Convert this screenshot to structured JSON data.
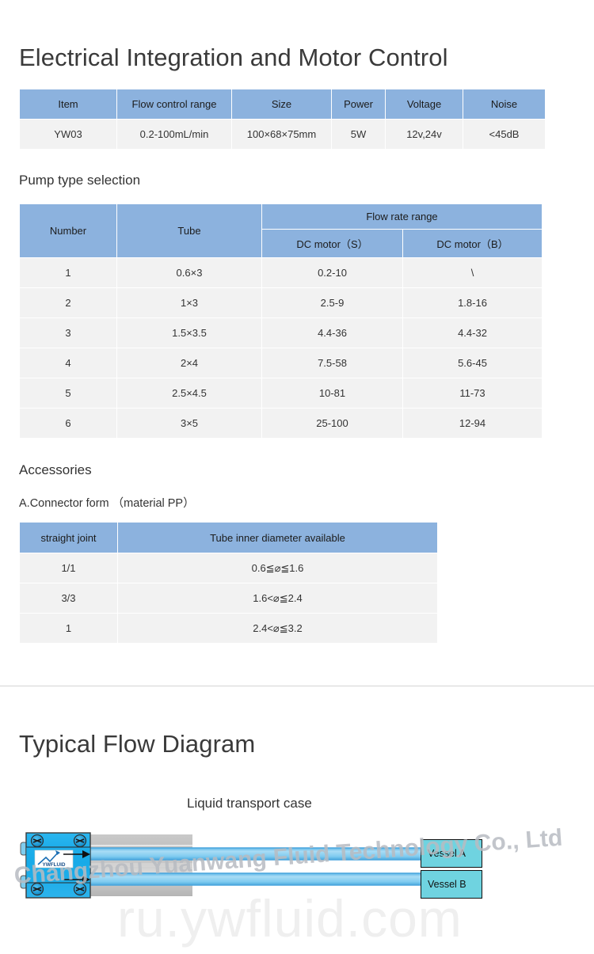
{
  "sections": {
    "electrical_title": "Electrical Integration and Motor Control",
    "pump_type_title": "Pump type selection",
    "accessories_title": "Accessories",
    "connector_title": "A.Connector form （material PP）",
    "flow_diagram_title": "Typical Flow Diagram",
    "flow_case_title": "Liquid transport case"
  },
  "spec_table": {
    "headers": [
      "Item",
      "Flow control range",
      "Size",
      "Power",
      "Voltage",
      "Noise"
    ],
    "rows": [
      [
        "YW03",
        "0.2-100mL/min",
        "100×68×75mm",
        "5W",
        "12v,24v",
        "<45dB"
      ]
    ]
  },
  "pump_table": {
    "header_number": "Number",
    "header_tube": "Tube",
    "header_flow_rate_range": "Flow rate range",
    "header_dc_motor_s": "DC motor（S）",
    "header_dc_motor_b": "DC motor（B）",
    "rows": [
      [
        "1",
        "0.6×3",
        "0.2-10",
        "\\"
      ],
      [
        "2",
        "1×3",
        "2.5-9",
        "1.8-16"
      ],
      [
        "3",
        "1.5×3.5",
        "4.4-36",
        "4.4-32"
      ],
      [
        "4",
        "2×4",
        "7.5-58",
        "5.6-45"
      ],
      [
        "5",
        "2.5×4.5",
        "10-81",
        "11-73"
      ],
      [
        "6",
        "3×5",
        "25-100",
        "12-94"
      ]
    ]
  },
  "connector_table": {
    "headers": [
      "straight joint",
      "Tube inner diameter available"
    ],
    "rows": [
      [
        "1/1",
        "0.6≦⌀≦1.6"
      ],
      [
        "3/3",
        "1.6<⌀≦2.4"
      ],
      [
        "1",
        "2.4<⌀≦3.2"
      ]
    ]
  },
  "diagram": {
    "pump_logo_text": "YWFLUID",
    "vessel_a_label": "Vessel A",
    "vessel_b_label": "Vessel B"
  },
  "watermarks": {
    "company": "Changzhou Yuanwang Fluid Technology Co., Ltd",
    "website": "ru.ywfluid.com"
  },
  "colors": {
    "header_blue": "#8cb2de",
    "row_grey": "#f2f2f2",
    "pump_blue": "#17a9e8",
    "tube_blue": "#7ec8ef",
    "vessel_cyan": "#6fd3e0"
  }
}
